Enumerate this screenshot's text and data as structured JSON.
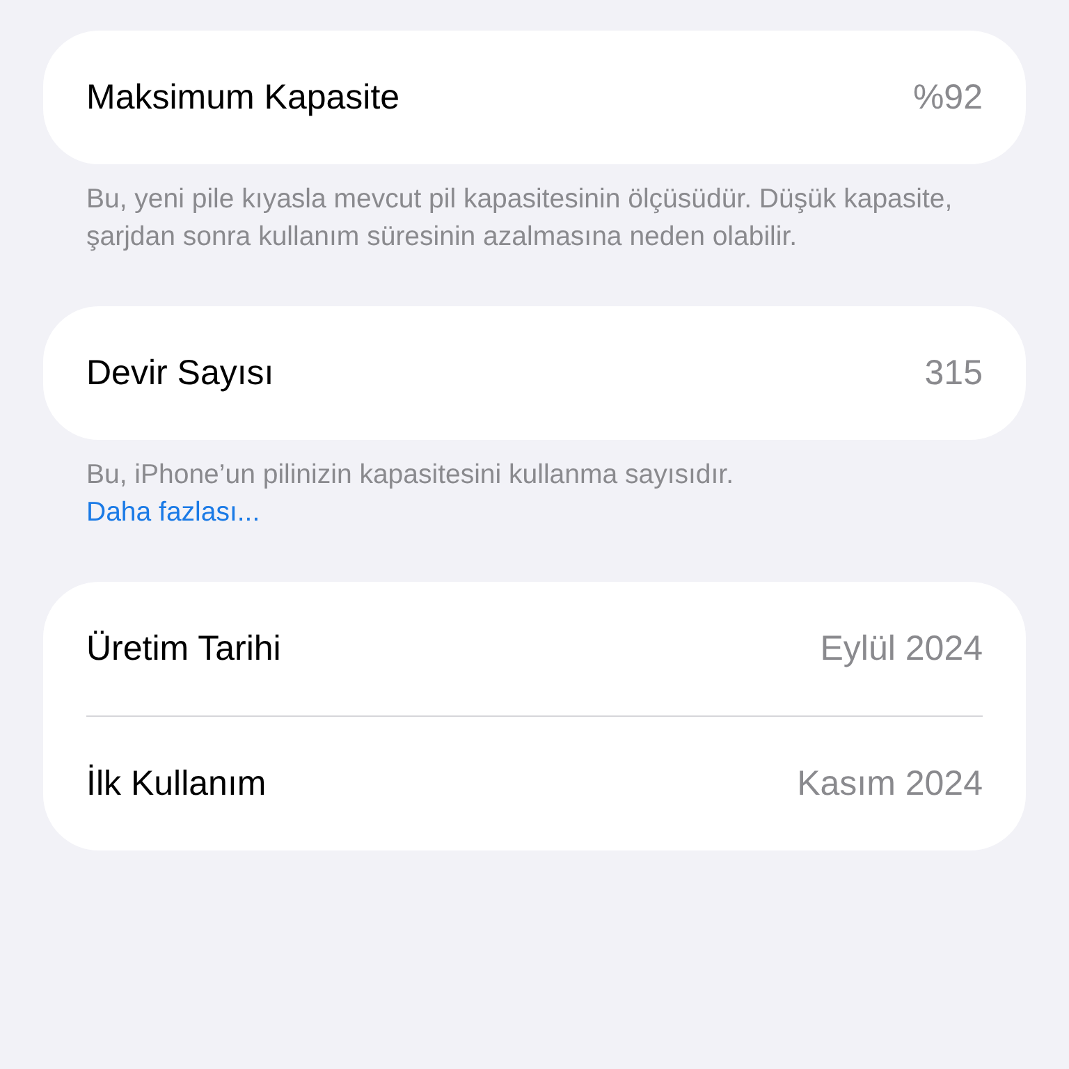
{
  "sections": [
    {
      "rows": [
        {
          "label": "Maksimum Kapasite",
          "value": "%92"
        }
      ],
      "footer": {
        "text": "Bu, yeni pile kıyasla mevcut pil kapasitesinin ölçüsüdür. Düşük kapasite, şarjdan sonra kullanım süresinin azalmasına neden olabilir."
      }
    },
    {
      "rows": [
        {
          "label": "Devir Sayısı",
          "value": "315"
        }
      ],
      "footer": {
        "text": "Bu, iPhone’un pilinizin kapasitesini kullanma sayısıdır.",
        "link": "Daha fazlası..."
      }
    },
    {
      "rows": [
        {
          "label": "Üretim Tarihi",
          "value": "Eylül 2024"
        },
        {
          "label": "İlk Kullanım",
          "value": "Kasım 2024"
        }
      ]
    }
  ]
}
